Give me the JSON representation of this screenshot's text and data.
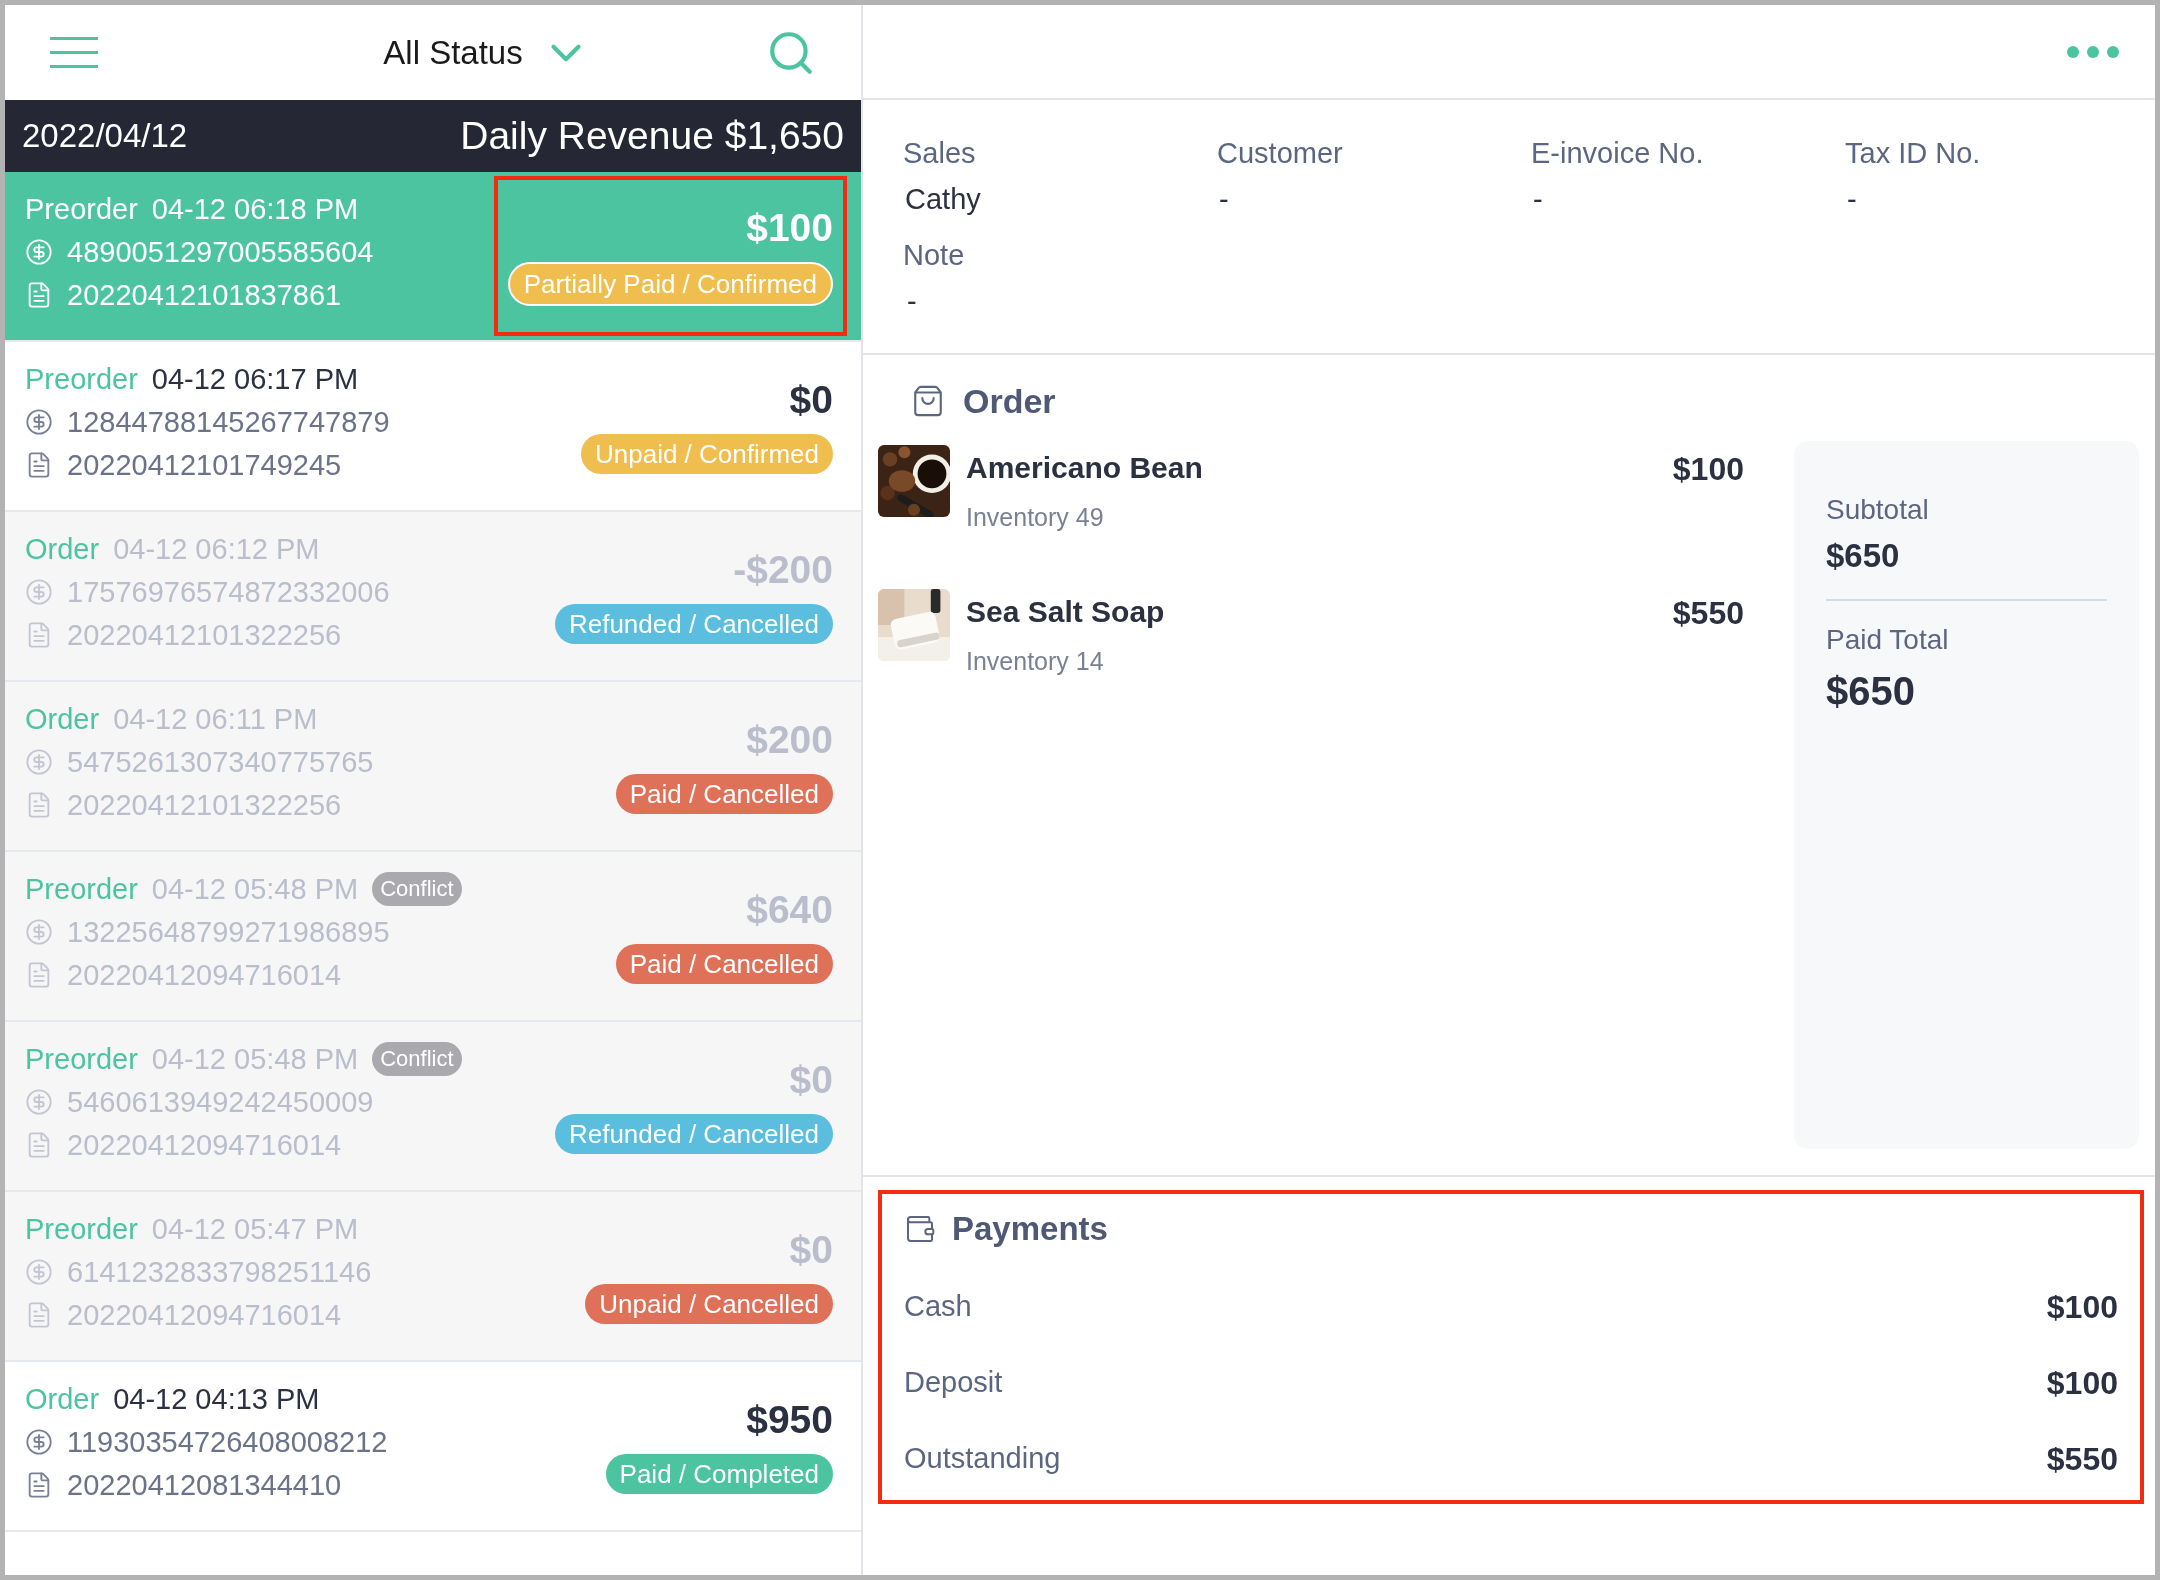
{
  "header": {
    "filter": "All Status"
  },
  "date_bar": {
    "date": "2022/04/12",
    "revenue": "Daily Revenue $1,650"
  },
  "orders": [
    {
      "type": "Preorder",
      "time": "04-12 06:18 PM",
      "payment_no": "4890051297005585604",
      "receipt_no": "20220412101837861",
      "amount": "$100",
      "status": "Partially Paid / Confirmed",
      "color": "#f0be4e",
      "selected": true,
      "cancelled": false,
      "highlighted": true
    },
    {
      "type": "Preorder",
      "time": "04-12 06:17 PM",
      "payment_no": "12844788145267747879",
      "receipt_no": "20220412101749245",
      "amount": "$0",
      "status": "Unpaid / Confirmed",
      "color": "#f0be4e",
      "selected": false,
      "cancelled": false,
      "highlighted": false
    },
    {
      "type": "Order",
      "time": "04-12 06:12 PM",
      "payment_no": "17576976574872332006",
      "receipt_no": "20220412101322256",
      "amount": "-$200",
      "status": "Refunded / Cancelled",
      "color": "#5bbedf",
      "selected": false,
      "cancelled": true,
      "highlighted": false
    },
    {
      "type": "Order",
      "time": "04-12 06:11 PM",
      "payment_no": "5475261307340775765",
      "receipt_no": "20220412101322256",
      "amount": "$200",
      "status": "Paid / Cancelled",
      "color": "#df7159",
      "selected": false,
      "cancelled": true,
      "highlighted": false
    },
    {
      "type": "Preorder",
      "time": "04-12 05:48 PM",
      "conflict": "Conflict",
      "payment_no": "13225648799271986895",
      "receipt_no": "20220412094716014",
      "amount": "$640",
      "status": "Paid / Cancelled",
      "color": "#df7159",
      "selected": false,
      "cancelled": true,
      "highlighted": false
    },
    {
      "type": "Preorder",
      "time": "04-12 05:48 PM",
      "conflict": "Conflict",
      "payment_no": "5460613949242450009",
      "receipt_no": "20220412094716014",
      "amount": "$0",
      "status": "Refunded / Cancelled",
      "color": "#5bbedf",
      "selected": false,
      "cancelled": true,
      "highlighted": false
    },
    {
      "type": "Preorder",
      "time": "04-12 05:47 PM",
      "payment_no": "6141232833798251146",
      "receipt_no": "20220412094716014",
      "amount": "$0",
      "status": "Unpaid / Cancelled",
      "color": "#df7159",
      "selected": false,
      "cancelled": true,
      "highlighted": false
    },
    {
      "type": "Order",
      "time": "04-12 04:13 PM",
      "payment_no": "11930354726408008212",
      "receipt_no": "20220412081344410",
      "amount": "$950",
      "status": "Paid / Completed",
      "color": "#4bc49f",
      "selected": false,
      "cancelled": false,
      "highlighted": false
    }
  ],
  "info": {
    "fields": [
      {
        "label": "Sales",
        "value": "Cathy"
      },
      {
        "label": "Customer",
        "value": "-"
      },
      {
        "label": "E-invoice No.",
        "value": "-"
      },
      {
        "label": "Tax ID No.",
        "value": "-"
      }
    ],
    "note": {
      "label": "Note",
      "value": "-"
    }
  },
  "order": {
    "title": "Order",
    "items": [
      {
        "name": "Americano Bean",
        "inventory": "Inventory 49",
        "price": "$100",
        "kind": "coffee"
      },
      {
        "name": "Sea Salt Soap",
        "inventory": "Inventory 14",
        "price": "$550",
        "kind": "soap"
      }
    ],
    "summary": [
      {
        "label": "Subtotal",
        "value": "$650"
      },
      {
        "label": "Paid Total",
        "value": "$650"
      }
    ]
  },
  "payments": {
    "title": "Payments",
    "highlighted": true,
    "rows": [
      {
        "label": "Cash",
        "value": "$100"
      },
      {
        "label": "Deposit",
        "value": "$100"
      },
      {
        "label": "Outstanding",
        "value": "$550"
      }
    ]
  }
}
